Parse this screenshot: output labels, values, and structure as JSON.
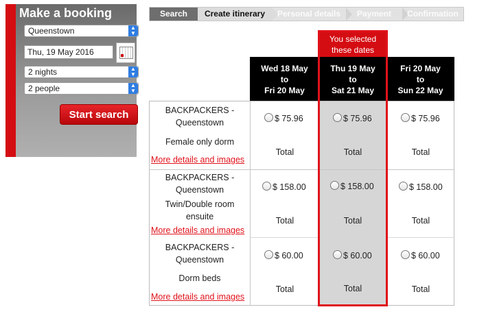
{
  "booking": {
    "title": "Make a booking",
    "location": "Queenstown",
    "date": "Thu, 19 May 2016",
    "nights": "2 nights",
    "people": "2 people",
    "search_label": "Start search"
  },
  "steps": [
    "Search",
    "Create itinerary",
    "Personal details",
    "Payment",
    "Confirmation"
  ],
  "selected_note": "You selected these dates",
  "date_columns": [
    {
      "from": "Wed 18 May",
      "to_word": "to",
      "to": "Fri 20 May"
    },
    {
      "from": "Thu 19 May",
      "to_word": "to",
      "to": "Sat 21 May"
    },
    {
      "from": "Fri 20 May",
      "to_word": "to",
      "to": "Sun 22 May"
    }
  ],
  "rooms": [
    {
      "name_line1": "BACKPACKERS -",
      "name_line2": "Queenstown",
      "type_line1": "Female only dorm",
      "type_line2": "",
      "link": "More details and images",
      "prices": [
        "$ 75.96",
        "$ 75.96",
        "$ 75.96"
      ],
      "total_label": "Total"
    },
    {
      "name_line1": "BACKPACKERS -",
      "name_line2": "Queenstown",
      "type_line1": "Twin/Double room",
      "type_line2": "ensuite",
      "link": "More details and images",
      "prices": [
        "$ 158.00",
        "$ 158.00",
        "$ 158.00"
      ],
      "total_label": "Total"
    },
    {
      "name_line1": "BACKPACKERS -",
      "name_line2": "Queenstown",
      "type_line1": "Dorm beds",
      "type_line2": "",
      "link": "More details and images",
      "prices": [
        "$ 60.00",
        "$ 60.00",
        "$ 60.00"
      ],
      "total_label": "Total"
    }
  ],
  "colors": {
    "brand_red": "#d40d12",
    "select_blue": "#2f7de2",
    "selected_column": "#d6d6d6"
  }
}
